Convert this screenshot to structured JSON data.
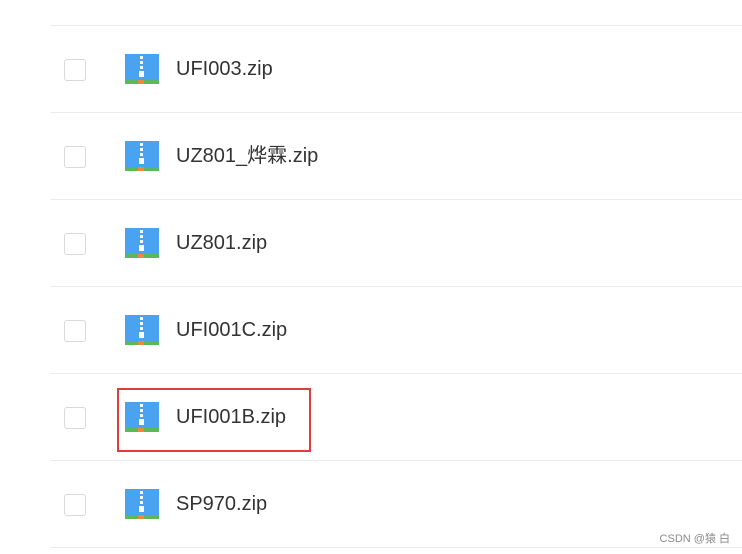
{
  "files": [
    {
      "name": "UFI003.zip",
      "icon": "zip-archive-icon",
      "checked": false
    },
    {
      "name": "UZ801_烨霖.zip",
      "icon": "zip-archive-icon",
      "checked": false
    },
    {
      "name": "UZ801.zip",
      "icon": "zip-archive-icon",
      "checked": false
    },
    {
      "name": "UFI001C.zip",
      "icon": "zip-archive-icon",
      "checked": false
    },
    {
      "name": "UFI001B.zip",
      "icon": "zip-archive-icon",
      "checked": false,
      "highlighted": true
    },
    {
      "name": "SP970.zip",
      "icon": "zip-archive-icon",
      "checked": false
    }
  ],
  "highlight_color": "#e03c3c",
  "watermark": "CSDN @猿 白"
}
